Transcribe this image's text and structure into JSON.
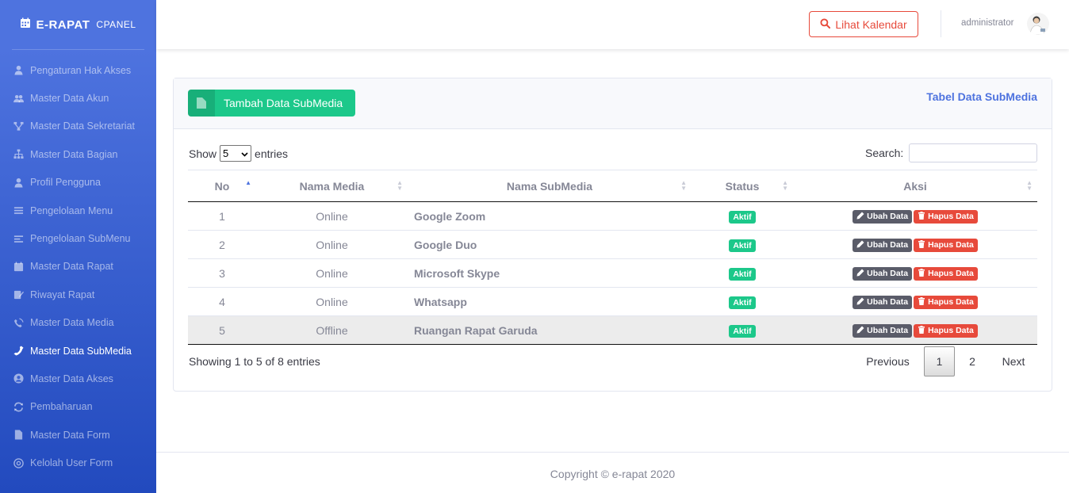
{
  "brand": {
    "name": "E-RAPAT",
    "sub": "CPANEL"
  },
  "sidebar": {
    "items": [
      {
        "label": "Pengaturan Hak Akses",
        "icon": "user-icon"
      },
      {
        "label": "Master Data Akun",
        "icon": "users-icon"
      },
      {
        "label": "Master Data Sekretariat",
        "icon": "network-icon"
      },
      {
        "label": "Master Data Bagian",
        "icon": "sitemap-icon"
      },
      {
        "label": "Profil Pengguna",
        "icon": "user-icon"
      },
      {
        "label": "Pengelolaan Menu",
        "icon": "bars-icon"
      },
      {
        "label": "Pengelolaan SubMenu",
        "icon": "align-icon"
      },
      {
        "label": "Master Data Rapat",
        "icon": "calendar-icon"
      },
      {
        "label": "Riwayat Rapat",
        "icon": "edit-icon"
      },
      {
        "label": "Master Data Media",
        "icon": "phone-volume-icon"
      },
      {
        "label": "Master Data SubMedia",
        "icon": "phone-icon",
        "active": true
      },
      {
        "label": "Master Data Akses",
        "icon": "user-circle-icon"
      },
      {
        "label": "Pembaharuan",
        "icon": "sync-icon"
      },
      {
        "label": "Master Data Form",
        "icon": "file-icon"
      },
      {
        "label": "Kelolah User Form",
        "icon": "at-icon"
      }
    ]
  },
  "topbar": {
    "calendar_button": "Lihat Kalendar",
    "user_name": "administrator"
  },
  "card": {
    "add_button": "Tambah Data SubMedia",
    "title": "Tabel Data SubMedia"
  },
  "table_controls": {
    "show": "Show",
    "entries_value": "5",
    "entries": "entries",
    "search_label": "Search:"
  },
  "table": {
    "columns": [
      "No",
      "Nama Media",
      "Nama SubMedia",
      "Status",
      "Aksi"
    ],
    "rows": [
      {
        "no": "1",
        "media": "Online",
        "submedia": "Google Zoom",
        "status": "Aktif"
      },
      {
        "no": "2",
        "media": "Online",
        "submedia": "Google Duo",
        "status": "Aktif"
      },
      {
        "no": "3",
        "media": "Online",
        "submedia": "Microsoft Skype",
        "status": "Aktif"
      },
      {
        "no": "4",
        "media": "Online",
        "submedia": "Whatsapp",
        "status": "Aktif"
      },
      {
        "no": "5",
        "media": "Offline",
        "submedia": "Ruangan Rapat Garuda",
        "status": "Aktif"
      }
    ],
    "edit_label": "Ubah Data",
    "delete_label": "Hapus Data"
  },
  "pagination": {
    "info": "Showing 1 to 5 of 8 entries",
    "previous": "Previous",
    "pages": [
      "1",
      "2"
    ],
    "next": "Next"
  },
  "footer": {
    "copyright": "Copyright © e-rapat 2020"
  },
  "colors": {
    "primary": "#4e73df",
    "success": "#1cc88a",
    "danger": "#e74a3b",
    "dark": "#5a5c69"
  }
}
